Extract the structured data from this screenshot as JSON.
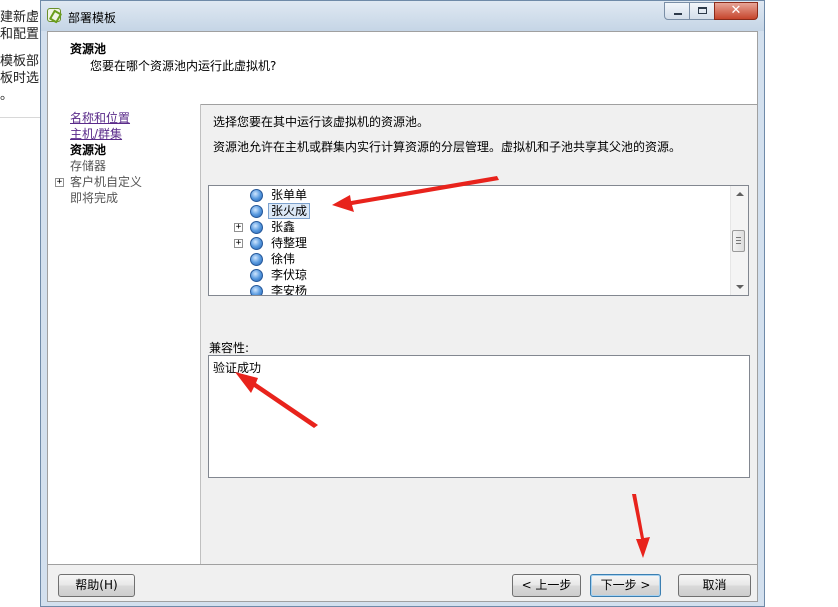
{
  "background": {
    "lines": [
      "建新虚",
      "和配置",
      "模板部",
      "板时选",
      "。"
    ]
  },
  "window": {
    "title": "部署模板",
    "controls": {
      "close_glyph": "✕"
    }
  },
  "header": {
    "title": "资源池",
    "subtitle": "您要在哪个资源池内运行此虚拟机?"
  },
  "nav": {
    "items": [
      {
        "label": "名称和位置"
      },
      {
        "label": "主机/群集"
      },
      {
        "label": "资源池"
      },
      {
        "label": "存储器"
      },
      {
        "label": "客户机自定义"
      },
      {
        "label": "即将完成"
      }
    ]
  },
  "main": {
    "instruction": "选择您要在其中运行该虚拟机的资源池。",
    "description": "资源池允许在主机或群集内实行计算资源的分层管理。虚拟机和子池共享其父池的资源。",
    "tree": {
      "items": [
        {
          "label": "张单单"
        },
        {
          "label": "张火成"
        },
        {
          "label": "张鑫"
        },
        {
          "label": "待整理"
        },
        {
          "label": "徐伟"
        },
        {
          "label": "李伏琼"
        },
        {
          "label": "李安杨"
        }
      ]
    },
    "compatibility_label": "兼容性:",
    "compatibility_text": "验证成功"
  },
  "footer": {
    "help": "帮助(H)",
    "back": "< 上一步",
    "next": "下一步 >",
    "cancel": "取消"
  },
  "colors": {
    "annotation_arrow": "#e8231c",
    "link": "#5a2b8a",
    "selection": "#dce9f7"
  }
}
